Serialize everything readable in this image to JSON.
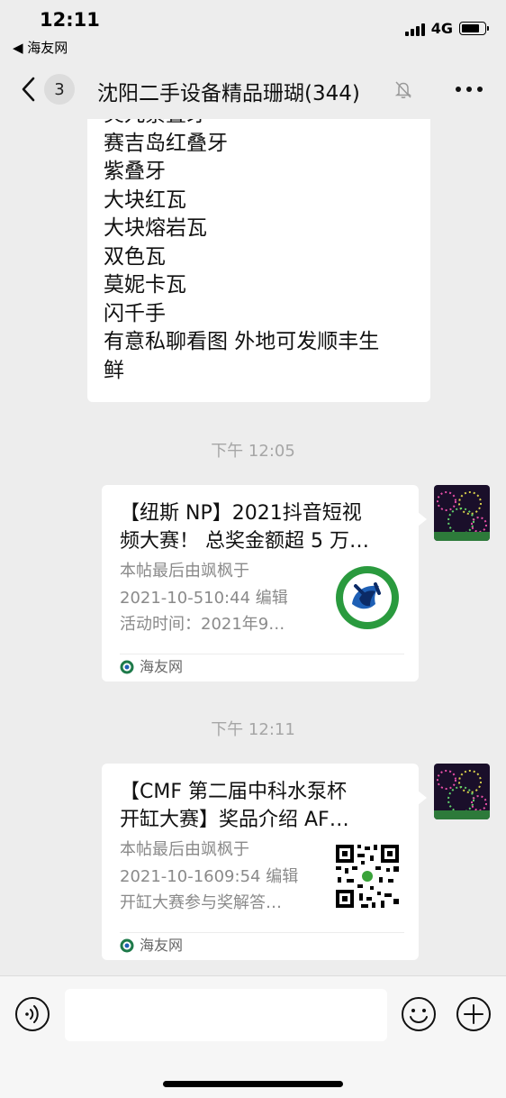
{
  "status_bar": {
    "time": "12:11",
    "back_app": "◀ 海友网",
    "network": "4G",
    "battery_level": 0.8
  },
  "nav": {
    "unread_count": "3",
    "title": "沈阳二手设备精品珊瑚(344)",
    "back_icon": "chevron-left-icon",
    "mute_icon": "bell-off-icon",
    "more_icon": "more-dots-icon"
  },
  "messages": {
    "text_bubble": {
      "lines": [
        "炎九紫叠牙",
        "赛吉岛红叠牙",
        "紫叠牙",
        "大块红瓦",
        "大块熔岩瓦",
        "双色瓦",
        "莫妮卡瓦",
        "闪千手",
        "有意私聊看图 外地可发顺丰生",
        "鲜"
      ]
    },
    "timestamp_1": "下午 12:05",
    "card_1": {
      "title_line1": "【纽斯 NP】2021抖音短视",
      "title_line2": "频大赛！ 总奖金额超 5 万…",
      "desc": [
        "本帖最后由飒枫于",
        "2021-10-510:44 编辑",
        "活动时间：2021年9…"
      ],
      "source": "海友网"
    },
    "timestamp_2": "下午 12:11",
    "card_2": {
      "title_line1": "【CMF 第二届中科水泵杯",
      "title_line2": "开缸大赛】奖品介绍 AF…",
      "desc": [
        "本帖最后由飒枫于",
        "2021-10-1609:54 编辑",
        "开缸大赛参与奖解答…"
      ],
      "source": "海友网"
    }
  },
  "input_bar": {
    "voice_icon": "voice-icon",
    "emoji_icon": "emoji-icon",
    "plus_icon": "plus-icon",
    "input_value": ""
  }
}
